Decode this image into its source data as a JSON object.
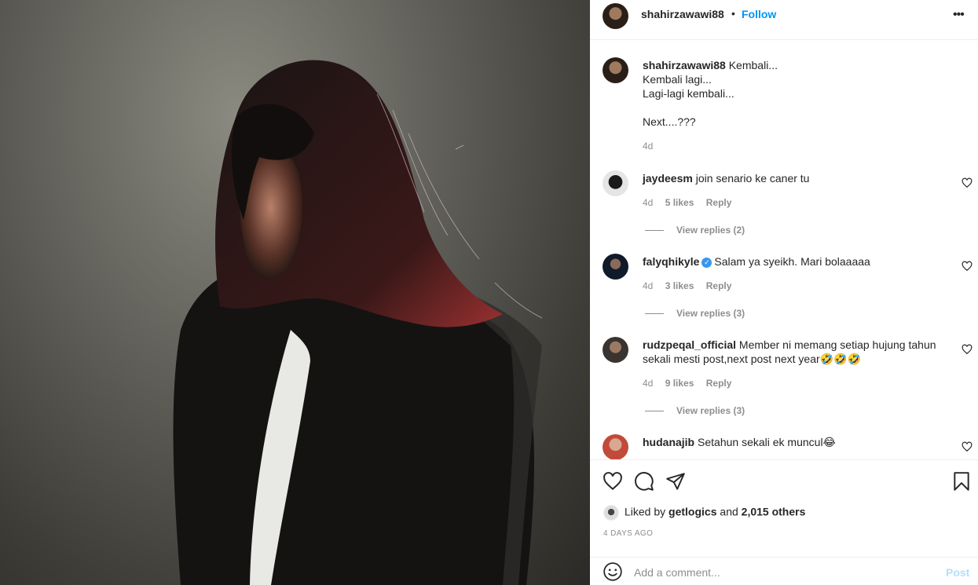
{
  "post": {
    "image_alt": "photo of man with long hair",
    "username": "shahirzawawi88",
    "dot": "•",
    "follow_label": "Follow",
    "more_icon": "more-horizontal-icon"
  },
  "caption": {
    "username": "shahirzawawi88",
    "line1": "Kembali...",
    "line2": "Kembali lagi...",
    "line3": "Lagi-lagi kembali...",
    "line4": "Next....???",
    "time": "4d"
  },
  "comments": [
    {
      "username": "jaydeesm",
      "text": "join senario ke caner tu",
      "time": "4d",
      "likes": "5 likes",
      "reply": "Reply",
      "view_replies": "View replies (2)"
    },
    {
      "username": "falyqhikyle",
      "verified": true,
      "text": "Salam ya syeikh. Mari bolaaaaa",
      "time": "4d",
      "likes": "3 likes",
      "reply": "Reply",
      "view_replies": "View replies (3)"
    },
    {
      "username": "rudzpeqal_official",
      "text": "Member ni memang setiap hujung tahun sekali mesti post,next post next year🤣🤣🤣",
      "time": "4d",
      "likes": "9 likes",
      "reply": "Reply",
      "view_replies": "View replies (3)"
    },
    {
      "username": "hudanajib",
      "text": "Setahun sekali ek muncul😂"
    }
  ],
  "actions": {
    "like_icon": "heart-icon",
    "comment_icon": "comment-icon",
    "share_icon": "paper-plane-icon",
    "save_icon": "bookmark-icon"
  },
  "likes": {
    "prefix": "Liked by",
    "user": "getlogics",
    "and": "and",
    "others": "2,015 others"
  },
  "timestamp": "4 DAYS AGO",
  "add_comment": {
    "placeholder": "Add a comment...",
    "post_label": "Post"
  },
  "colors": {
    "accent": "#0095f6",
    "post_disabled": "#b2dffc",
    "secondary_text": "#8e8e8e",
    "verified": "#3897f0"
  }
}
